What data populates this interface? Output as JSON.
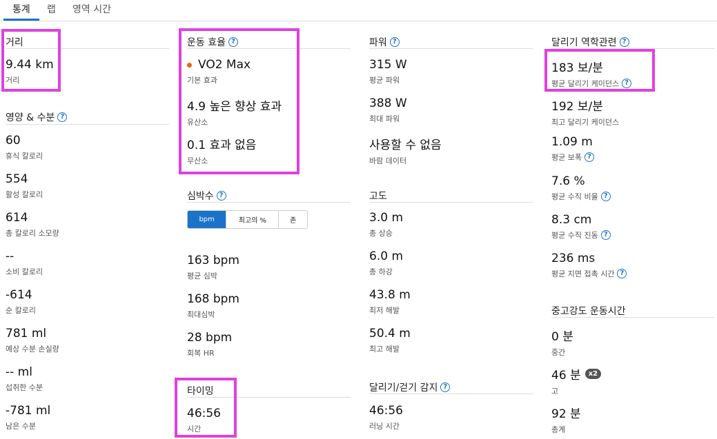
{
  "tabs": [
    {
      "label": "통계"
    },
    {
      "label": "랩"
    },
    {
      "label": "영역 시간"
    }
  ],
  "distance": {
    "title": "거리",
    "value": "9.44 km",
    "label": "거리"
  },
  "nutrition": {
    "title": "영양 & 수분",
    "items": [
      {
        "value": "60",
        "label": "휴식 칼로리"
      },
      {
        "value": "554",
        "label": "활성 칼로리"
      },
      {
        "value": "614",
        "label": "총 칼로리 소모량"
      },
      {
        "value": "--",
        "label": "소비 칼로리"
      },
      {
        "value": "-614",
        "label": "순 칼로리"
      },
      {
        "value": "781 ml",
        "label": "예상 수분 손실량"
      },
      {
        "value": "-- ml",
        "label": "섭취한 수분"
      },
      {
        "value": "-781 ml",
        "label": "남은 수분"
      }
    ]
  },
  "training_effect": {
    "title": "운동 효율",
    "items": [
      {
        "value": "VO2 Max",
        "label": "기본 효과",
        "dot_color": "#e06a10"
      },
      {
        "value": "4.9 높은 향상 효과",
        "label": "유산소"
      },
      {
        "value": "0.1 효과 없음",
        "label": "무산소"
      }
    ]
  },
  "heart_rate": {
    "title": "심박수",
    "toggle": [
      "bpm",
      "최고의 %",
      "존"
    ],
    "selected": "bpm",
    "items": [
      {
        "value": "163 bpm",
        "label": "평균 심박"
      },
      {
        "value": "168 bpm",
        "label": "최대심박"
      },
      {
        "value": "28 bpm",
        "label": "회복 HR"
      }
    ]
  },
  "timing": {
    "title": "타이밍",
    "value": "46:56",
    "label": "시간"
  },
  "power": {
    "title": "파워",
    "items": [
      {
        "value": "315 W",
        "label": "평균 파워"
      },
      {
        "value": "388 W",
        "label": "최대 파워"
      },
      {
        "value": "사용할 수 없음",
        "label": "바람 데이터"
      }
    ]
  },
  "elevation": {
    "title": "고도",
    "items": [
      {
        "value": "3.0 m",
        "label": "총 상승"
      },
      {
        "value": "6.0 m",
        "label": "총 하강"
      },
      {
        "value": "43.8 m",
        "label": "최저 해발"
      },
      {
        "value": "50.4 m",
        "label": "최고 해발"
      }
    ]
  },
  "run_walk": {
    "title": "달리기/걷기 감지",
    "value": "46:56",
    "label": "러닝 시간"
  },
  "running_dynamics": {
    "title": "달리기 역학관련",
    "items": [
      {
        "value": "183 보/분",
        "label": "평균 달리기 케이던스"
      },
      {
        "value": "192 보/분",
        "label": "최고 달리기 케이던스"
      },
      {
        "value": "1.09 m",
        "label": "평균 보폭"
      },
      {
        "value": "7.6 %",
        "label": "평균 수직 비율"
      },
      {
        "value": "8.3 cm",
        "label": "평균 수직 진동"
      },
      {
        "value": "236 ms",
        "label": "평균 지면 접촉 시간"
      }
    ]
  },
  "intensity": {
    "title": "중고강도 운동시간",
    "items": [
      {
        "value": "0 분",
        "label": "중간"
      },
      {
        "value": "46 분",
        "label": "고",
        "badge": "x2"
      },
      {
        "value": "92 분",
        "label": "총계"
      }
    ]
  },
  "colors": {
    "accent": "#1a73c9",
    "highlight": "#e040e0"
  }
}
